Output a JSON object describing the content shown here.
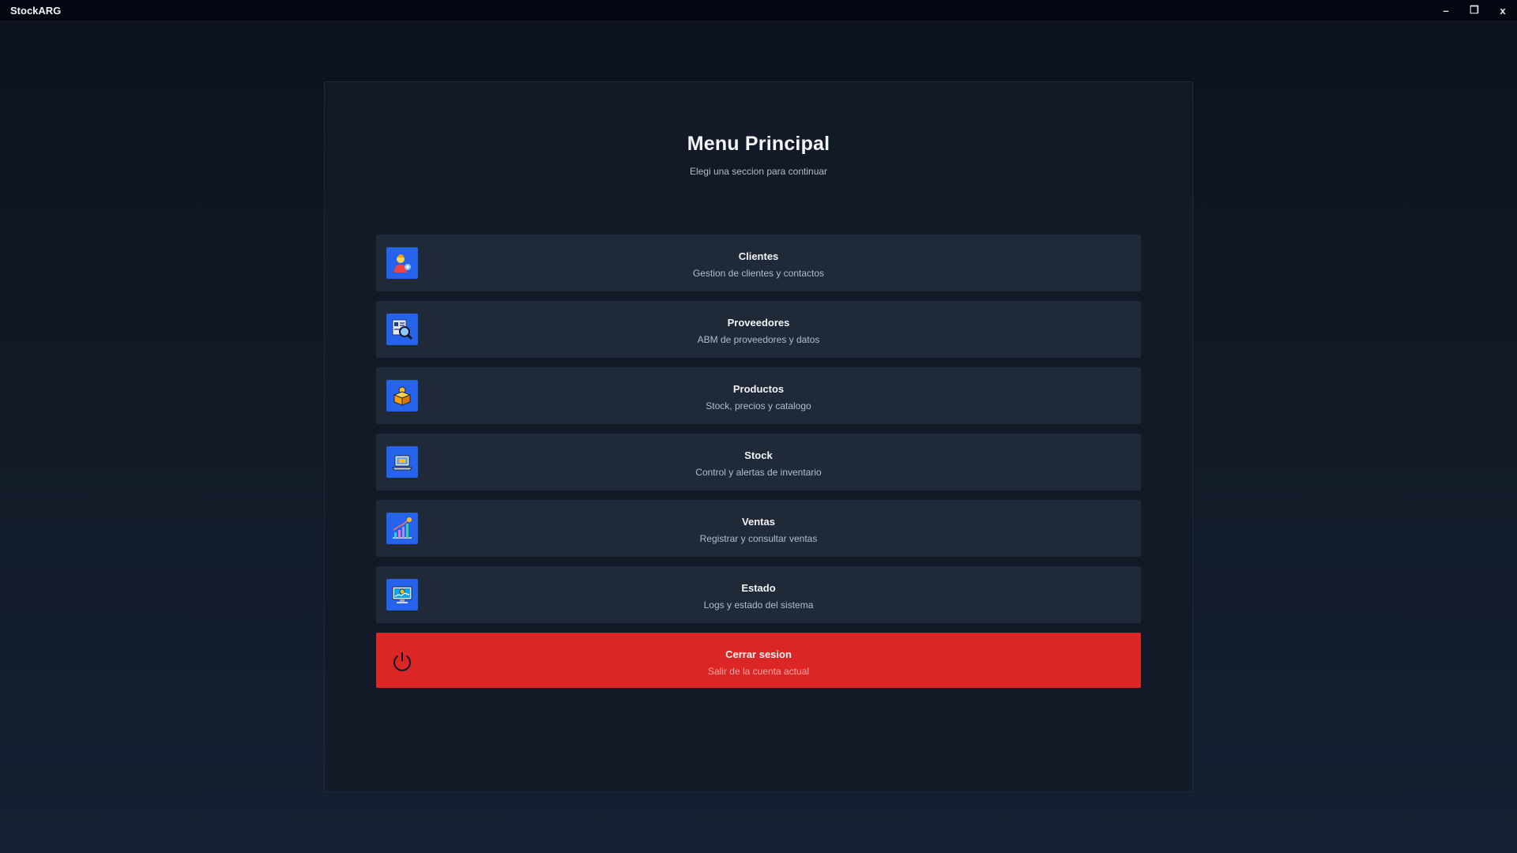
{
  "window": {
    "title": "StockARG",
    "controls": {
      "minimize": "–",
      "maximize": "❐",
      "close": "x"
    }
  },
  "header": {
    "title": "Menu Principal",
    "subtitle": "Elegi una seccion para continuar"
  },
  "menu": {
    "items": [
      {
        "label": "Clientes",
        "description": "Gestion de clientes y contactos",
        "icon": "clients-icon"
      },
      {
        "label": "Proveedores",
        "description": "ABM de proveedores y datos",
        "icon": "suppliers-icon"
      },
      {
        "label": "Productos",
        "description": "Stock, precios y catalogo",
        "icon": "products-icon"
      },
      {
        "label": "Stock",
        "description": "Control y alertas de inventario",
        "icon": "stock-icon"
      },
      {
        "label": "Ventas",
        "description": "Registrar y consultar ventas",
        "icon": "sales-chart-icon"
      },
      {
        "label": "Estado",
        "description": "Logs y estado del sistema",
        "icon": "system-status-icon"
      }
    ],
    "logout": {
      "label": "Cerrar sesion",
      "description": "Salir de la cuenta actual",
      "icon": "power-icon"
    }
  },
  "colors": {
    "accent": "#2563eb",
    "danger": "#dc2626",
    "card": "#1f2937",
    "panel": "#121a27",
    "titlebar": "#030712"
  }
}
